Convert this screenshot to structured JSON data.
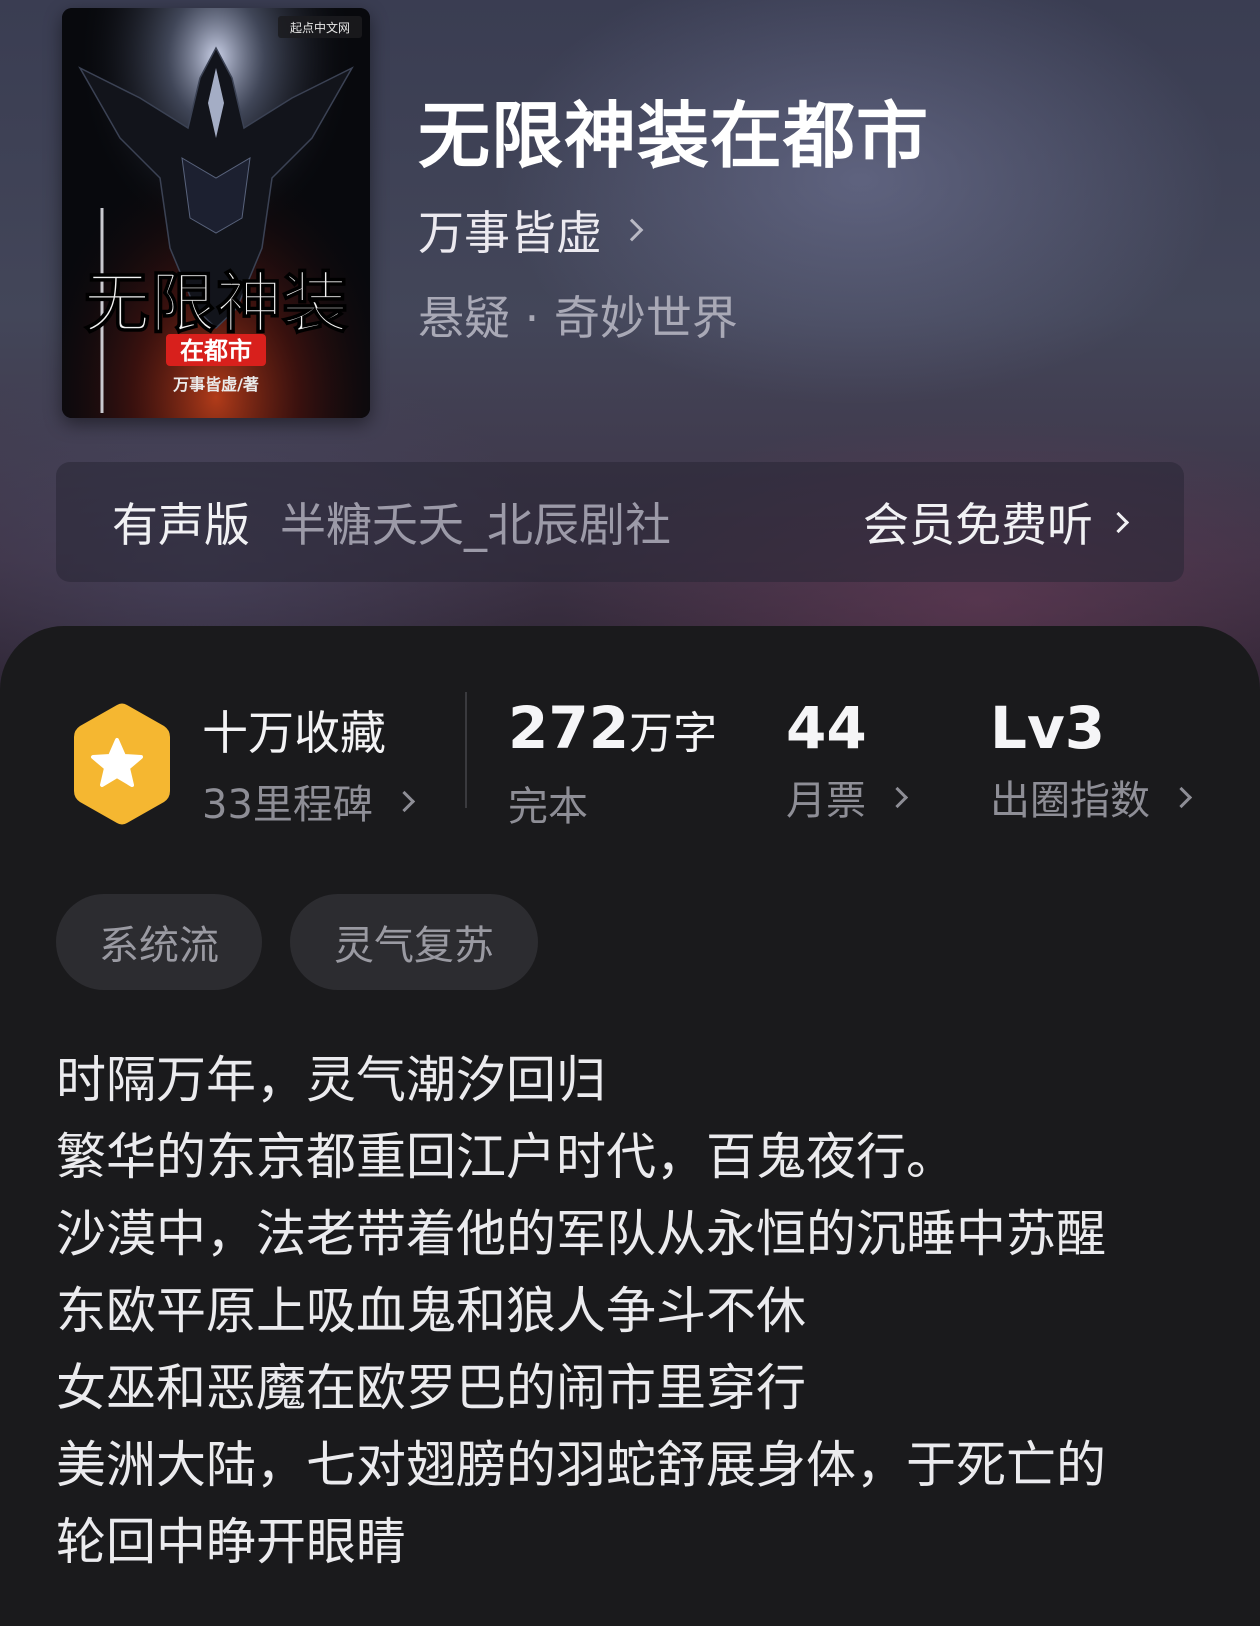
{
  "book": {
    "title": "无限神装在都市",
    "author": "万事皆虚",
    "genre": "悬疑 · 奇妙世界",
    "cover": {
      "title_main": "无限神装",
      "title_sub": "在都市",
      "author_credit": "万事皆虚/著",
      "publisher": "起点中文网"
    }
  },
  "audio": {
    "label": "有声版",
    "narrator": "半糖夭夭_北辰剧社",
    "cta": "会员免费听"
  },
  "stats": {
    "collect": {
      "main": "十万收藏",
      "sub": "33里程碑"
    },
    "words": {
      "number": "272",
      "unit": "万字",
      "sub": "完本"
    },
    "tickets": {
      "number": "44",
      "sub": "月票"
    },
    "level": {
      "number": "Lv3",
      "sub": "出圈指数"
    }
  },
  "tags": [
    "系统流",
    "灵气复苏"
  ],
  "synopsis": [
    "时隔万年，灵气潮汐回归",
    "繁华的东京都重回江户时代，百鬼夜行。",
    "沙漠中，法老带着他的军队从永恒的沉睡中苏醒",
    "东欧平原上吸血鬼和狼人争斗不休",
    "女巫和恶魔在欧罗巴的闹市里穿行",
    "美洲大陆，七对翅膀的羽蛇舒展身体，于死亡的",
    "轮回中睁开眼睛"
  ],
  "colors": {
    "badge": "#f5b731",
    "panel": "#1a1a1c",
    "tag_bg": "#2c2c30",
    "cover_red": "#d8201c"
  }
}
